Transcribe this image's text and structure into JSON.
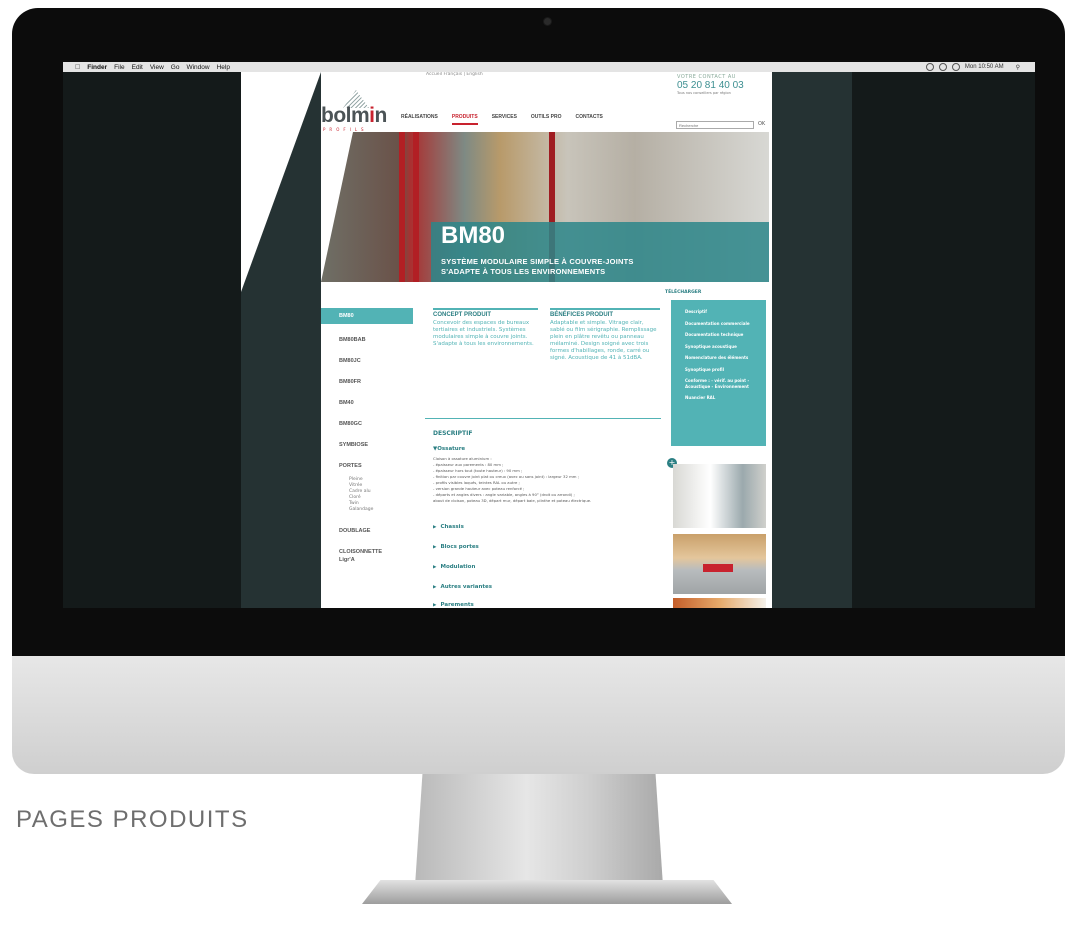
{
  "caption": "PAGES PRODUITS",
  "mac_menu": {
    "apple": "",
    "items": [
      "Finder",
      "File",
      "Edit",
      "View",
      "Go",
      "Window",
      "Help"
    ],
    "clock": "Mon 10:50 AM"
  },
  "site": {
    "logo": {
      "word_start": "bolm",
      "word_accent": "i",
      "word_end": "n",
      "sub": "PROFILS"
    },
    "lang_bar": "Accueil   Français | English",
    "nav": [
      {
        "label": "RÉALISATIONS",
        "active": false
      },
      {
        "label": "PRODUITS",
        "active": true
      },
      {
        "label": "SERVICES",
        "active": false
      },
      {
        "label": "OUTILS PRO",
        "active": false
      },
      {
        "label": "CONTACTS",
        "active": false
      }
    ],
    "contact": {
      "label": "VOTRE CONTACT AU",
      "phone": "05 20 81 40 03",
      "note": "Tous nos conseillers par région"
    },
    "search": {
      "placeholder": "Recherche",
      "button": "OK"
    },
    "hero": {
      "title": "BM80",
      "subtitle_line1": "SYSTÈME MODULAIRE SIMPLE À COUVRE-JOINTS",
      "subtitle_line2": "S'ADAPTE À TOUS LES ENVIRONNEMENTS"
    },
    "product_menu": {
      "active": "BM80",
      "items": [
        "BM80BAB",
        "BM80JC",
        "BM80FR",
        "BM40",
        "BM80GC",
        "SYMBIOSE"
      ],
      "portes_title": "PORTES",
      "portes_sub": [
        "Pleine",
        "Vitrée",
        "Cadre alu",
        "Cloré",
        "Twin",
        "Galandage"
      ],
      "bottom": [
        "DOUBLAGE",
        "CLOISONNETTE",
        "Ligr'A"
      ]
    },
    "concept": {
      "title": "CONCEPT PRODUIT",
      "text": "Concevoir des espaces de bureaux tertiaires et industriels. Systèmes modulaires simple à couvre joints. S'adapte à tous les environnements."
    },
    "benefits": {
      "title": "BÉNÉFICES PRODUIT",
      "text": "Adaptable et simple. Vitrage clair, sablé ou film sérigraphie. Remplissage plein en plâtre revêtu ou panneau mélaminé. Design soigné avec trois formes d'habillages, ronde, carré ou signé. Acoustique de 41 à 51dBA."
    },
    "descriptif": {
      "title": "DESCRIPTIF",
      "ossature_title": "▼Ossature",
      "ossature_text": "Cloison à ossature aluminium :\n- épaisseur aux parements : 80 mm ;\n- épaisseur hors tout (toute hauteur) : 90 mm ;\n- finition par couvre joint plat ou creux (avec ou sans joint) : largeur 32 mm ;\n- profils visibles laqués, teintes RAL ou autre ;\n- version grande hauteur avec poteau renforcé ;\n- départs et angles divers : angle variable, angles à 90° (droit ou arrondi) ;\nabout de cloison, poteau 3D, départ mur, départ baie, plinthe et poteau électrique.",
      "sections": [
        "Chassis",
        "Blocs portes",
        "Modulation",
        "Autres variantes",
        "Parements"
      ]
    },
    "download": {
      "label": "TÉLÉCHARGER",
      "items": [
        "Descriptif",
        "Documentation commerciale",
        "Documentation technique",
        "Synoptique acoustique",
        "Nomenclature des éléments",
        "Synoptique profil",
        "Conforme : - vérif. au point - Acoustique - Environnement",
        "Nuancier RAL"
      ]
    }
  }
}
